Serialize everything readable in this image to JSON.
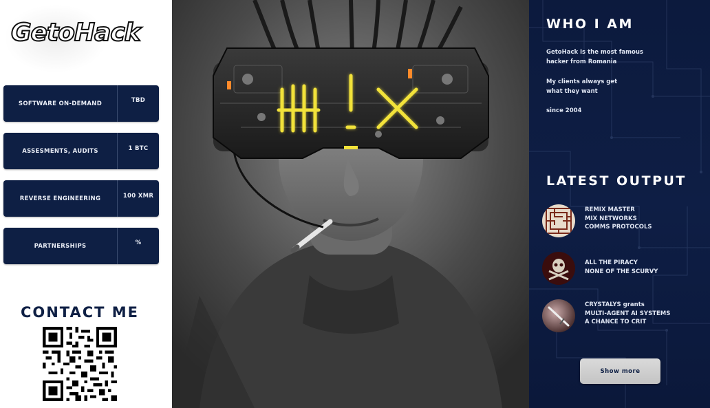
{
  "brand": {
    "logo_text": "GetoHack"
  },
  "services": [
    {
      "name": "Software on-demand",
      "price": "TBD"
    },
    {
      "name": "Assesments, audits",
      "price": "1 BTC"
    },
    {
      "name": "Reverse Engineering",
      "price": "100 XMR"
    },
    {
      "name": "Partnerships",
      "price": "%"
    }
  ],
  "contact": {
    "title": "Contact me"
  },
  "about": {
    "title": "Who I am",
    "lines": [
      "GetoHack is the most famous hacker from Romania",
      "My clients always get what they want",
      "since 2004"
    ]
  },
  "output": {
    "title": "Latest Output",
    "items": [
      {
        "text": "REMIX MASTER\nMIX NETWORKS\nCOMMS PROTOCOLS",
        "icon": "circuit-maze-icon"
      },
      {
        "text": "ALL THE PIRACY\nNONE OF THE SCURVY",
        "icon": "pirate-skull-icon"
      },
      {
        "text": "CRYSTALYS grants\nMULTI-AGENT AI SYSTEMS\nA CHANCE TO CRIT",
        "icon": "crystal-sword-icon"
      }
    ],
    "more_label": "Show more"
  },
  "colors": {
    "navy": "#0e1f44",
    "panel": "#0c1a3d",
    "button": "#d0d0d0",
    "visor_glow": "#f2e23a"
  }
}
